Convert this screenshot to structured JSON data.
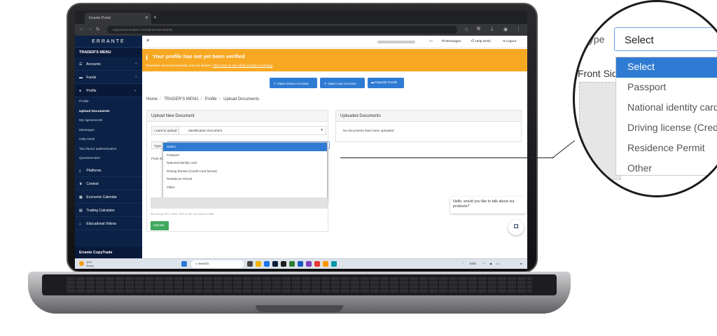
{
  "browser": {
    "tab_title": "Errante Portal",
    "url": "myaccount.errante.com/upload-documents"
  },
  "sidebar": {
    "logo": "ERRANTE",
    "menu_title": "TRADER'S MENU",
    "items": [
      {
        "label": "Accounts",
        "icon": "list-icon"
      },
      {
        "label": "Funds",
        "icon": "wallet-icon"
      },
      {
        "label": "Profile",
        "icon": "user-icon"
      }
    ],
    "profile_sub": [
      "Profile",
      "Upload Documents",
      "My Agreements",
      "Messages",
      "Help Desk",
      "Two-factor authentication",
      "Questionnaire"
    ],
    "more_items": [
      {
        "label": "Platforms",
        "icon": "download-icon"
      },
      {
        "label": "Contest",
        "icon": "trophy-icon"
      },
      {
        "label": "Economic Calendar",
        "icon": "calendar-icon"
      },
      {
        "label": "Trading Calculator",
        "icon": "calculator-icon"
      },
      {
        "label": "Educational Videos",
        "icon": "bank-icon"
      }
    ],
    "bottom": "Errante CopyTrade"
  },
  "topbar": {
    "messages": "Messages",
    "helpdesk": "Help Desk",
    "logout": "Logout"
  },
  "banner": {
    "title": "Your profile has not yet been verified",
    "text": "Therefore some functionality may be limited.",
    "link": "Click here to see what exactly is missing"
  },
  "buttons": {
    "demo": "Open Demo Account",
    "live": "Open Live Account",
    "deposit": "Deposit Funds"
  },
  "breadcrumb": [
    "Home",
    "TRADER'S MENU",
    "Profile",
    "Upload Documents"
  ],
  "upload_panel": {
    "title": "Upload New Document",
    "want_label": "I want to upload",
    "want_value": "Identification Document",
    "type_label": "Type",
    "type_value": "Select",
    "front_label": "Front Side",
    "hint": "We accept JPG, JPEG, PDF or GIF not exceed 10MB",
    "upload_btn": "Upload"
  },
  "dropdown": {
    "options": [
      "Select",
      "Passport",
      "National identity card",
      "Driving license (Credit Card format)",
      "Residence Permit",
      "Other"
    ],
    "selected": "Select"
  },
  "uploaded_panel": {
    "title": "Uploaded Documents",
    "empty": "No documents have been uploaded"
  },
  "chat": {
    "message": "Hello, would you like to talk about our products?"
  },
  "taskbar": {
    "temp": "10°C",
    "weather": "Sunny",
    "search": "Search",
    "lang": "ENG"
  },
  "zoom": {
    "type_label": "Type",
    "select_value": "Select",
    "front_label": "Front Side",
    "options": [
      "Select",
      "Passport",
      "National identity card",
      "Driving license (Credit Card format)",
      "Residence Permit",
      "Other"
    ]
  },
  "colors": {
    "sidebar": "#0b2145",
    "banner": "#f7a823",
    "accent": "#2f7bd3",
    "upload": "#3ea85f"
  }
}
